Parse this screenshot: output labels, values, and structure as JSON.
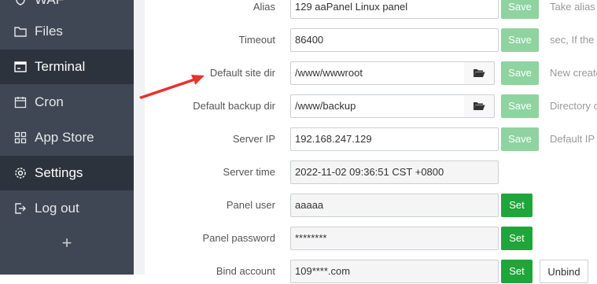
{
  "sidebar": {
    "items": [
      {
        "label": "WAF",
        "icon": "shield-icon",
        "active": false
      },
      {
        "label": "Files",
        "icon": "folder-icon",
        "active": false
      },
      {
        "label": "Terminal",
        "icon": "terminal-icon",
        "active": true
      },
      {
        "label": "Cron",
        "icon": "calendar-icon",
        "active": false
      },
      {
        "label": "App Store",
        "icon": "grid-icon",
        "active": false
      },
      {
        "label": "Settings",
        "icon": "gear-icon",
        "active": false
      },
      {
        "label": "Log out",
        "icon": "logout-icon",
        "active": false
      }
    ],
    "add_label": "+"
  },
  "form": {
    "alias": {
      "label": "Alias",
      "value": "129 aaPanel Linux panel",
      "button": "Save",
      "hint": "Take alias f"
    },
    "timeout": {
      "label": "Timeout",
      "value": "86400",
      "button": "Save",
      "hint": "sec, If the u"
    },
    "site_dir": {
      "label": "Default site dir",
      "value": "/www/wwwroot",
      "button": "Save",
      "hint": "New create"
    },
    "backup_dir": {
      "label": "Default backup dir",
      "value": "/www/backup",
      "button": "Save",
      "hint": "Directory o"
    },
    "server_ip": {
      "label": "Server IP",
      "value": "192.168.247.129",
      "button": "Save",
      "hint": "Default IP"
    },
    "server_time": {
      "label": "Server time",
      "value": "2022-11-02 09:36:51 CST +0800"
    },
    "panel_user": {
      "label": "Panel user",
      "value": "aaaaa",
      "button": "Set"
    },
    "panel_password": {
      "label": "Panel password",
      "value": "********",
      "button": "Set"
    },
    "bind_account": {
      "label": "Bind account",
      "value": "109****.com",
      "button": "Set",
      "unbind": "Unbind"
    }
  },
  "colors": {
    "sidebar_bg": "#3e4753",
    "active_bg": "#2c333c",
    "save_green_light": "#8fd3a0",
    "set_green": "#20a53a",
    "arrow_red": "#e8322b"
  }
}
